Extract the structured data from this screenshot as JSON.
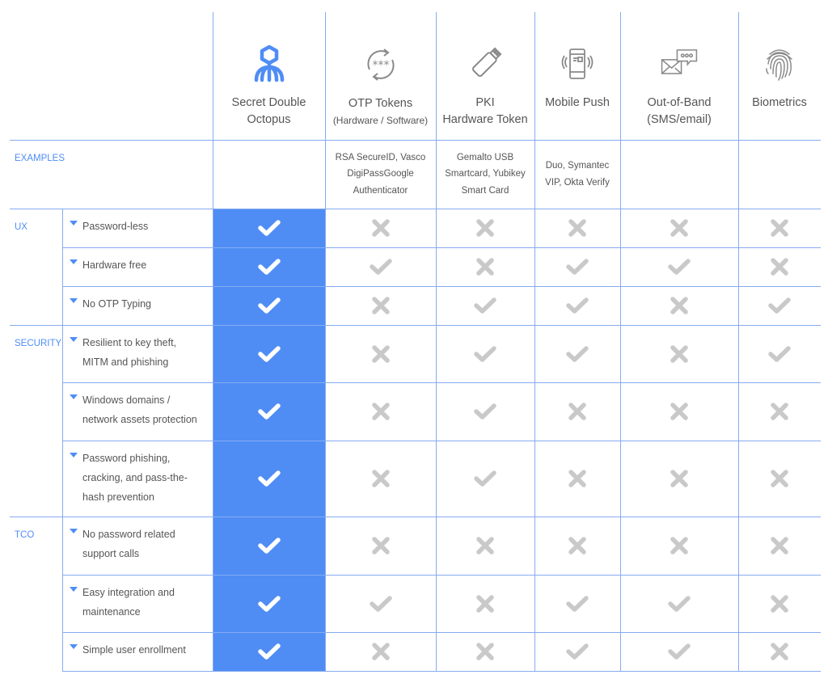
{
  "colors": {
    "accent": "#4f8df5",
    "grid": "#86abf0",
    "mark_gray": "#c9c9c9",
    "mark_white": "#ffffff"
  },
  "columns": [
    {
      "id": "sdo",
      "title": "Secret Double",
      "title2": "Octopus",
      "subtitle": "",
      "icon": "octopus-icon",
      "examples": []
    },
    {
      "id": "otp",
      "title": "OTP Tokens",
      "title2": "",
      "subtitle": "(Hardware / Software)",
      "icon": "otp-refresh-icon",
      "examples": [
        "RSA SecureID, Vasco",
        "DigiPassGoogle",
        "Authenticator"
      ]
    },
    {
      "id": "pki",
      "title": "PKI",
      "title2": "Hardware Token",
      "subtitle": "",
      "icon": "usb-token-icon",
      "examples": [
        "Gemalto USB",
        "Smartcard, Yubikey",
        "Smart Card"
      ]
    },
    {
      "id": "push",
      "title": "Mobile Push",
      "title2": "",
      "subtitle": "",
      "icon": "mobile-push-icon",
      "examples": [
        "Duo, Symantec",
        "VIP, Okta Verify"
      ]
    },
    {
      "id": "oob",
      "title": "Out-of-Band",
      "title2": "(SMS/email)",
      "subtitle": "",
      "icon": "envelope-chat-icon",
      "examples": []
    },
    {
      "id": "bio",
      "title": "Biometrics",
      "title2": "",
      "subtitle": "",
      "icon": "fingerprint-icon",
      "examples": []
    }
  ],
  "examples_label": "EXAMPLES",
  "categories": [
    {
      "label": "UX",
      "rows": [
        0,
        1,
        2
      ]
    },
    {
      "label": "SECURITY",
      "rows": [
        3,
        4,
        5
      ]
    },
    {
      "label": "TCO",
      "rows": [
        6,
        7,
        8
      ]
    }
  ],
  "features": [
    {
      "label": "Password-less",
      "values": [
        true,
        false,
        false,
        false,
        false,
        false
      ]
    },
    {
      "label": "Hardware free",
      "values": [
        true,
        true,
        false,
        true,
        true,
        false
      ]
    },
    {
      "label": "No OTP Typing",
      "values": [
        true,
        false,
        true,
        true,
        false,
        true
      ]
    },
    {
      "label": "Resilient to key theft, MITM and phishing",
      "values": [
        true,
        false,
        true,
        true,
        false,
        true
      ]
    },
    {
      "label": "Windows domains / network assets protection",
      "values": [
        true,
        false,
        true,
        false,
        false,
        false
      ]
    },
    {
      "label": "Password phishing, cracking, and pass-the-hash prevention",
      "values": [
        true,
        false,
        true,
        false,
        false,
        false
      ]
    },
    {
      "label": "No password related support calls",
      "values": [
        true,
        false,
        false,
        false,
        false,
        false
      ]
    },
    {
      "label": "Easy integration and maintenance",
      "values": [
        true,
        true,
        false,
        true,
        true,
        false
      ]
    },
    {
      "label": "Simple user enrollment",
      "values": [
        true,
        false,
        false,
        true,
        true,
        false
      ]
    }
  ]
}
